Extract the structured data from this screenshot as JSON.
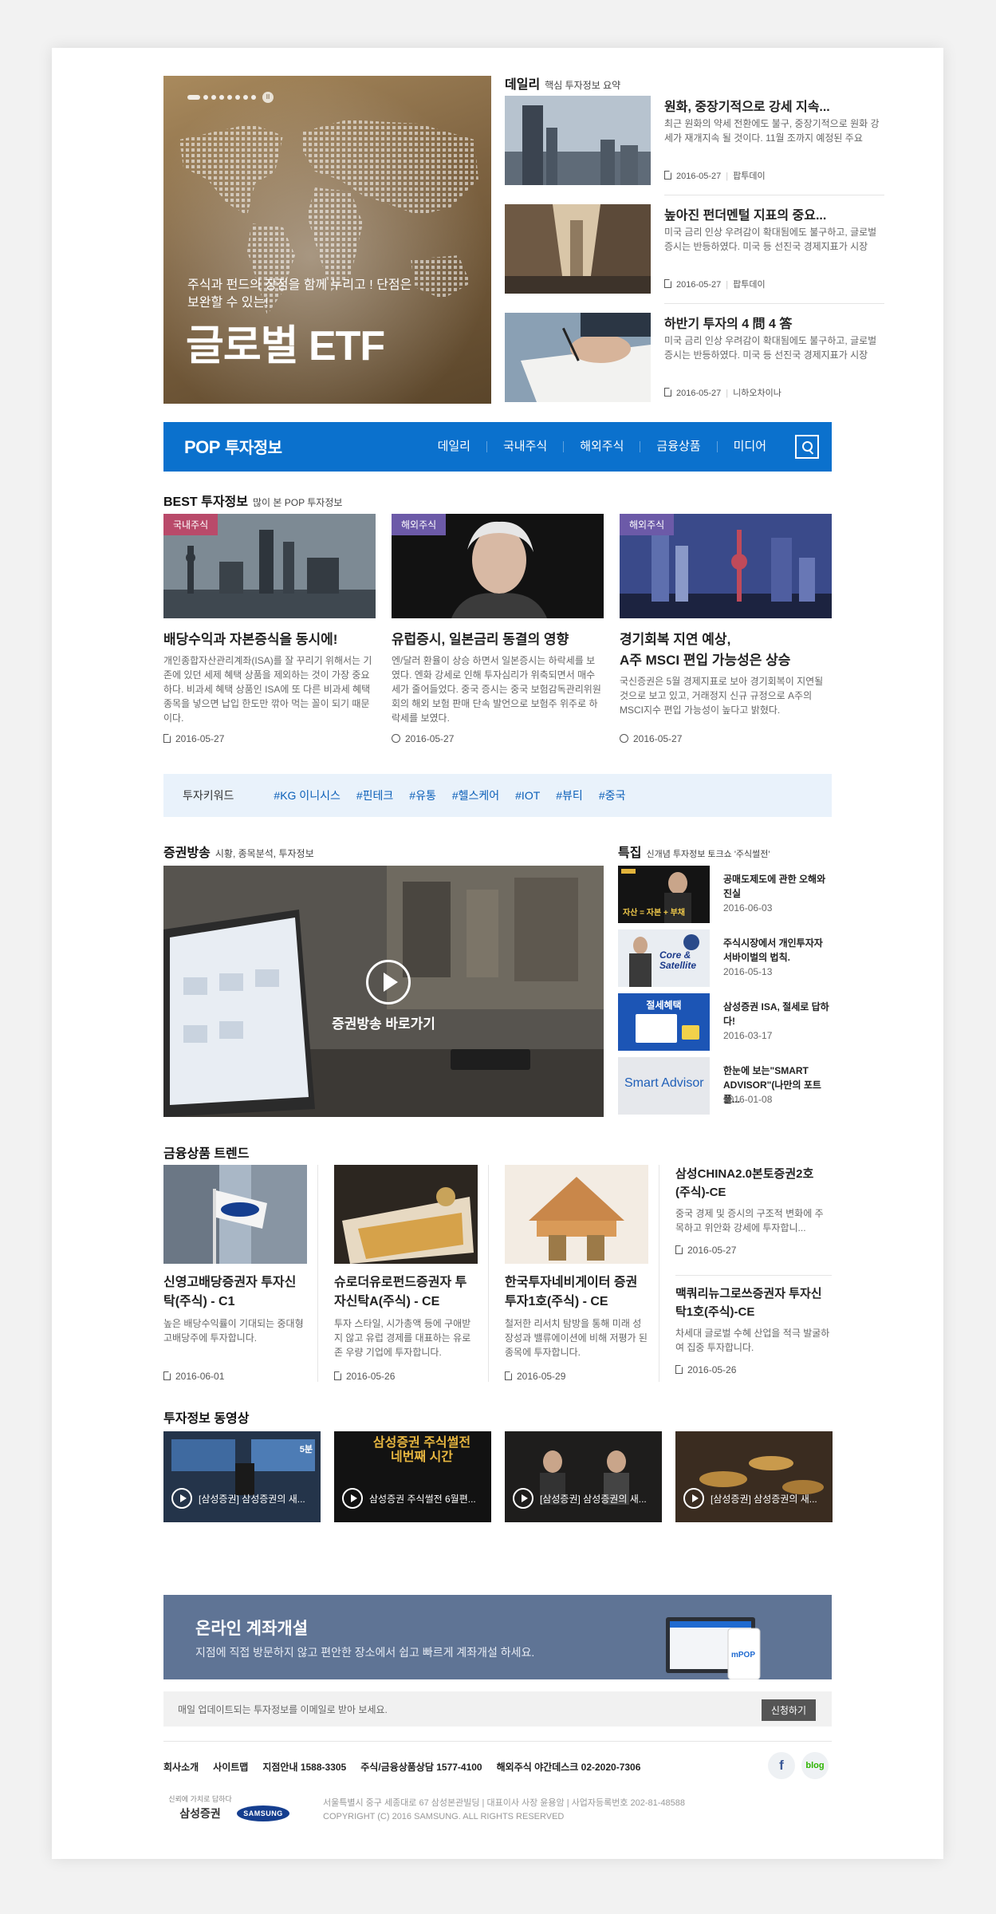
{
  "hero": {
    "subtitle": "주식과 펀드의 장점을 함께 누리고 ! 단점은 보완할 수 있는!",
    "title": "글로벌 ETF",
    "pause_label": "II"
  },
  "daily": {
    "title": "데일리",
    "subtitle": "핵심 투자정보 요약",
    "items": [
      {
        "title": "원화, 중장기적으로 강세 지속...",
        "desc": "최근 원화의 약세 전환에도 불구, 중장기적으로 원화 강세가 재개지속 될 것이다. 11월 조까지 예정된 주요",
        "date": "2016-05-27",
        "source": "팝투데이"
      },
      {
        "title": "높아진 펀더멘털 지표의 중요...",
        "desc": "미국 금리 인상 우려감이 확대됨에도 불구하고, 글로벌 증시는 반등하였다. 미국 등 선진국 경제지표가 시장",
        "date": "2016-05-27",
        "source": "팝투데이"
      },
      {
        "title": "하반기 투자의 4 問 4 答",
        "desc": "미국 금리 인상 우려감이 확대됨에도 불구하고, 글로벌 증시는 반등하였다. 미국 등 선진국 경제지표가 시장",
        "date": "2016-05-27",
        "source": "니하오차이나"
      }
    ]
  },
  "nav": {
    "logo": "POP",
    "logo_text": "투자정보",
    "items": [
      "데일리",
      "국내주식",
      "해외주식",
      "금융상품",
      "미디어"
    ]
  },
  "best": {
    "title": "BEST 투자정보",
    "subtitle": "많이 본 POP 투자정보",
    "items": [
      {
        "tag": "국내주식",
        "title": "배당수익과 자본증식을 동시에!",
        "desc": "개인종합자산관리계좌(ISA)를 잘 꾸리기 위해서는 기존에 있던 세제 혜택 상품을 제외하는 것이 가장 중요하다. 비과세 혜택 상품인 ISA에 또 다른 비과세 혜택 종목을 넣으면 납입 한도만 깎아 먹는 꼴이 되기 때문이다.",
        "date": "2016-05-27"
      },
      {
        "tag": "해외주식",
        "title": "유럽증시, 일본금리 동결의 영향",
        "desc": "엔/달러 환율이 상승 하면서 일본증시는 하락세를 보였다. 엔화 강세로 인해 투자심리가 위축되면서 매수세가 줄어들었다. 중국 증시는 중국 보험감독관리위원회의 해외 보험 판매 단속 발언으로 보험주 위주로 하락세를 보였다.",
        "date": "2016-05-27"
      },
      {
        "tag": "해외주식",
        "title": "경기회복 지연 예상,\nA주 MSCI 편입 가능성은 상승",
        "desc": "국신증권은 5월 경제지표로 보아 경기회복이 지연될 것으로 보고 있고, 거래정지 신규 규정으로 A주의 MSCI지수 편입 가능성이 높다고 밝혔다.",
        "date": "2016-05-27"
      }
    ]
  },
  "keywords": {
    "label": "투자키워드",
    "items": [
      "#KG 이니시스",
      "#핀테크",
      "#유통",
      "#헬스케어",
      "#IOT",
      "#뷰티",
      "#중국"
    ]
  },
  "broadcast": {
    "title": "증권방송",
    "subtitle": "시황, 종목분석, 투자정보",
    "cta": "증권방송 바로가기"
  },
  "special": {
    "title": "특집",
    "subtitle": "신개념 투자정보 토크쇼 '주식썰전'",
    "items": [
      {
        "title": "공매도제도에 관한 오해와 진실",
        "date": "2016-06-03",
        "thumb_text": "자산 = 자본 + 부채"
      },
      {
        "title": "주식시장에서 개인투자자 서바이벌의 법칙.",
        "date": "2016-05-13",
        "thumb_text": "Core & Satellite"
      },
      {
        "title": "삼성증권 ISA, 절세로 답하다!",
        "date": "2016-03-17",
        "thumb_text": "절세혜택"
      },
      {
        "title": "한눈에 보는\"SMART ADVISOR\"(나만의 포트폴...",
        "date": "2016-01-08",
        "thumb_text": "Smart Advisor"
      }
    ]
  },
  "trend": {
    "title": "금융상품 트렌드",
    "items": [
      {
        "title": "신영고배당증권자 투자신탁(주식) - C1",
        "desc": "높은 배당수익률이 기대되는 중대형 고배당주에 투자합니다.",
        "date": "2016-06-01"
      },
      {
        "title": "슈로더유로펀드증권자 투자신탁A(주식) - CE",
        "desc": "투자 스타일, 시가총액 등에 구애받지 않고 유럽 경제를 대표하는 유로존 우량 기업에 투자합니다.",
        "date": "2016-05-26"
      },
      {
        "title": "한국투자네비게이터 증권투자1호(주식) - CE",
        "desc": "철저한 리서치 탐방을 통해 미래 성장성과 밸류에이션에 비해 저평가 된 종목에 투자합니다.",
        "date": "2016-05-29"
      }
    ],
    "side": [
      {
        "title": "삼성CHINA2.0본토증권2호 (주식)-CE",
        "desc": "중국 경제 및 증시의 구조적 변화에 주목하고 위안화 강세에 투자합니...",
        "date": "2016-05-27"
      },
      {
        "title": "맥쿼리뉴그로쓰증권자 투자신탁1호(주식)-CE",
        "desc": "차세대 글로벌 수혜 산업을 적극 발굴하여 집중 투자합니다.",
        "date": "2016-05-26"
      }
    ]
  },
  "videos": {
    "title": "투자정보 동영상",
    "items": [
      "[삼성증권] 삼성증권의 새...",
      "삼성증권 주식썰전 6월편...",
      "[삼성증권] 삼성증권의 새...",
      "[삼성증권] 삼성증권의 새..."
    ],
    "thumb_texts": [
      "5분",
      "삼성증권 주식썰전 네번째 시간"
    ]
  },
  "account": {
    "title": "온라인 계좌개설",
    "desc": "지점에 직접 방문하지 않고 편안한 장소에서 쉽고 빠르게 계좌개설 하세요.",
    "phone_text": "mPOP"
  },
  "mail": {
    "text": "매일 업데이트되는 투자정보를 이메일로 받아 보세요.",
    "button": "신청하기"
  },
  "footer": {
    "links": [
      "회사소개",
      "사이트맵",
      "지점안내 1588-3305",
      "주식/금융상품상담 1577-4100",
      "해외주식 야간데스크 02-2020-7306"
    ],
    "facebook": "f",
    "blog": "blog",
    "brand_tagline": "신뢰에 가치로 답하다",
    "brand_name": "삼성증권",
    "brand2": "SAMSUNG",
    "address": "서울특별시 중구 세종대로 67 삼성본관빌딩 | 대표이사 사장 윤용암 | 사업자등록번호 202-81-48588",
    "copyright": "COPYRIGHT (C) 2016 SAMSUNG. ALL RIGHTS RESERVED"
  },
  "colors": {
    "brand_blue": "#0b71cd",
    "tag_red": "#b94a6a",
    "tag_purple": "#6c5aa8",
    "account_bg": "#5f7495",
    "keyword_blue": "#0b5fb8"
  }
}
